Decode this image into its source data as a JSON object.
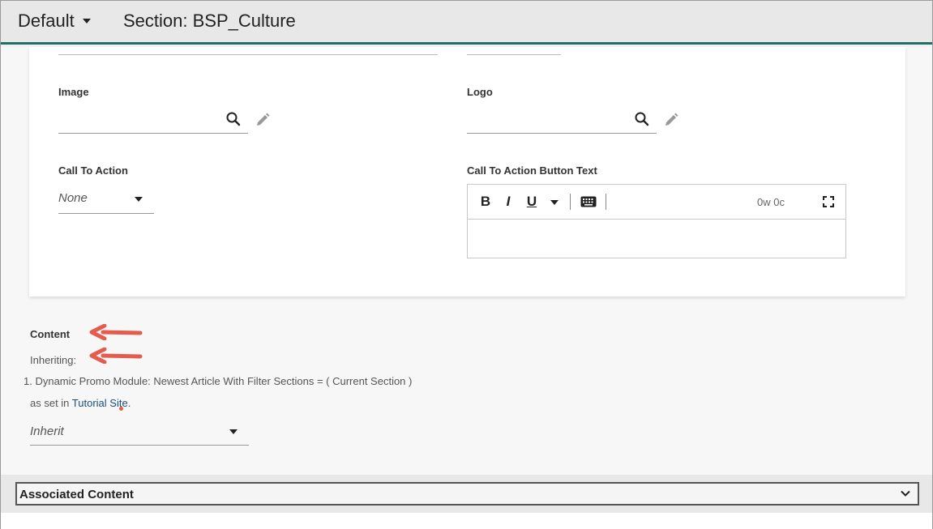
{
  "header": {
    "content_type": "Default",
    "section_title": "Section: BSP_Culture"
  },
  "form": {
    "image_label": "Image",
    "logo_label": "Logo",
    "cta_label": "Call To Action",
    "cta_value": "None",
    "cta_button_text_label": "Call To Action Button Text",
    "rte": {
      "bold": "B",
      "italic": "I",
      "underline": "U",
      "word_count": "0w 0c"
    }
  },
  "content_section": {
    "label": "Content",
    "inheriting": "Inheriting:",
    "inherited_items": [
      "1. Dynamic Promo Module: Newest Article With Filter Sections = ( Current Section )"
    ],
    "as_set_in_prefix": "as set in ",
    "site_link": "Tutorial Site",
    "as_set_in_suffix": ".",
    "select_value": "Inherit"
  },
  "associated": {
    "title": "Associated Content"
  },
  "colors": {
    "accent": "#1f6f68",
    "annotation_arrow": "#e55b4d",
    "link": "#1a4f7a"
  },
  "icons": {
    "search": "search-icon",
    "pencil": "pencil-icon",
    "keyboard": "keyboard-icon",
    "fullscreen": "fullscreen-icon",
    "chevron": "chevron-down-icon"
  }
}
